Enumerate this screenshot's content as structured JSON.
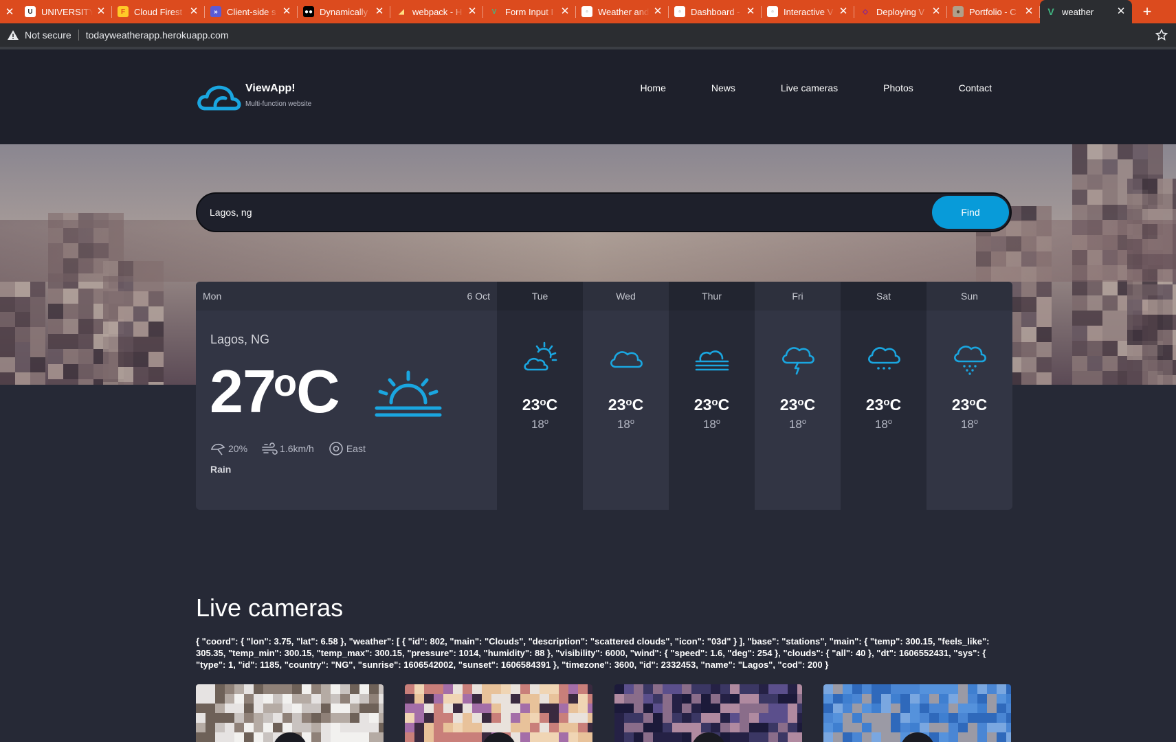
{
  "browser": {
    "tabs": [
      {
        "title": "UNIVERSITY",
        "fav_bg": "#ffffff",
        "fav_fg": "#333333",
        "fav_glyph": "U"
      },
      {
        "title": "Cloud Firest",
        "fav_bg": "#ffca28",
        "fav_fg": "#e64a19",
        "fav_glyph": "F"
      },
      {
        "title": "Client-side s",
        "fav_bg": "#5b5bd6",
        "fav_fg": "#ffffff",
        "fav_glyph": "»"
      },
      {
        "title": "Dynamically",
        "fav_bg": "#000000",
        "fav_fg": "#ffffff",
        "fav_glyph": "●●"
      },
      {
        "title": "webpack - H",
        "fav_bg": "#dc4b1e",
        "fav_fg": "#ffe082",
        "fav_glyph": "◢"
      },
      {
        "title": "Form Input I",
        "fav_bg": "#dc4b1e",
        "fav_fg": "#41b883",
        "fav_glyph": "V"
      },
      {
        "title": "Weather and",
        "fav_bg": "#ffffff",
        "fav_fg": "#888888",
        "fav_glyph": "▫"
      },
      {
        "title": "Dashboard -",
        "fav_bg": "#ffffff",
        "fav_fg": "#888888",
        "fav_glyph": "▫"
      },
      {
        "title": "Interactive V",
        "fav_bg": "#ffffff",
        "fav_fg": "#888888",
        "fav_glyph": "▫"
      },
      {
        "title": "Deploying V",
        "fav_bg": "#dc4b1e",
        "fav_fg": "#7b1fa2",
        "fav_glyph": "◇"
      },
      {
        "title": "Portfolio - C",
        "fav_bg": "#b0a08a",
        "fav_fg": "#5a4632",
        "fav_glyph": "●"
      }
    ],
    "active_tab": {
      "title": "weather",
      "fav_fg": "#41b883",
      "fav_glyph": "V"
    },
    "not_secure": "Not secure",
    "url": "todayweatherapp.herokuapp.com"
  },
  "site": {
    "brand": "ViewApp!",
    "tagline": "Multi-function website",
    "nav": [
      "Home",
      "News",
      "Live cameras",
      "Photos",
      "Contact"
    ],
    "accent_color": "#089bd9"
  },
  "search": {
    "value": "Lagos, ng",
    "button": "Find"
  },
  "today": {
    "day": "Mon",
    "date": "6 Oct",
    "location": "Lagos, NG",
    "temp": "27",
    "unit": "o",
    "unit_c": "C",
    "icon": "sunrise-icon",
    "humidity": "20%",
    "wind": "1.6km/h",
    "direction": "East",
    "description": "Rain"
  },
  "forecast": [
    {
      "day": "Tue",
      "icon": "partly-sunny-icon",
      "hi": "23",
      "lo": "18"
    },
    {
      "day": "Wed",
      "icon": "cloud-icon",
      "hi": "23",
      "lo": "18"
    },
    {
      "day": "Thur",
      "icon": "fog-icon",
      "hi": "23",
      "lo": "18"
    },
    {
      "day": "Fri",
      "icon": "thunderstorm-icon",
      "hi": "23",
      "lo": "18"
    },
    {
      "day": "Sat",
      "icon": "drizzle-icon",
      "hi": "23",
      "lo": "18"
    },
    {
      "day": "Sun",
      "icon": "snow-icon",
      "hi": "23",
      "lo": "18"
    }
  ],
  "degree": "o",
  "degree_c": "C",
  "live_cameras": {
    "title": "Live cameras",
    "json_dump": "{ \"coord\": { \"lon\": 3.75, \"lat\": 6.58 }, \"weather\": [ { \"id\": 802, \"main\": \"Clouds\", \"description\": \"scattered clouds\", \"icon\": \"03d\" } ], \"base\": \"stations\", \"main\": { \"temp\": 300.15, \"feels_like\": 305.35, \"temp_min\": 300.15, \"temp_max\": 300.15, \"pressure\": 1014, \"humidity\": 88 }, \"visibility\": 6000, \"wind\": { \"speed\": 1.6, \"deg\": 254 }, \"clouds\": { \"all\": 40 }, \"dt\": 1606552431, \"sys\": { \"type\": 1, \"id\": 1185, \"country\": \"NG\", \"sunrise\": 1606542002, \"sunset\": 1606584391 }, \"timezone\": 3600, \"id\": 2332453, \"name\": \"Lagos\", \"cod\": 200 }"
  }
}
